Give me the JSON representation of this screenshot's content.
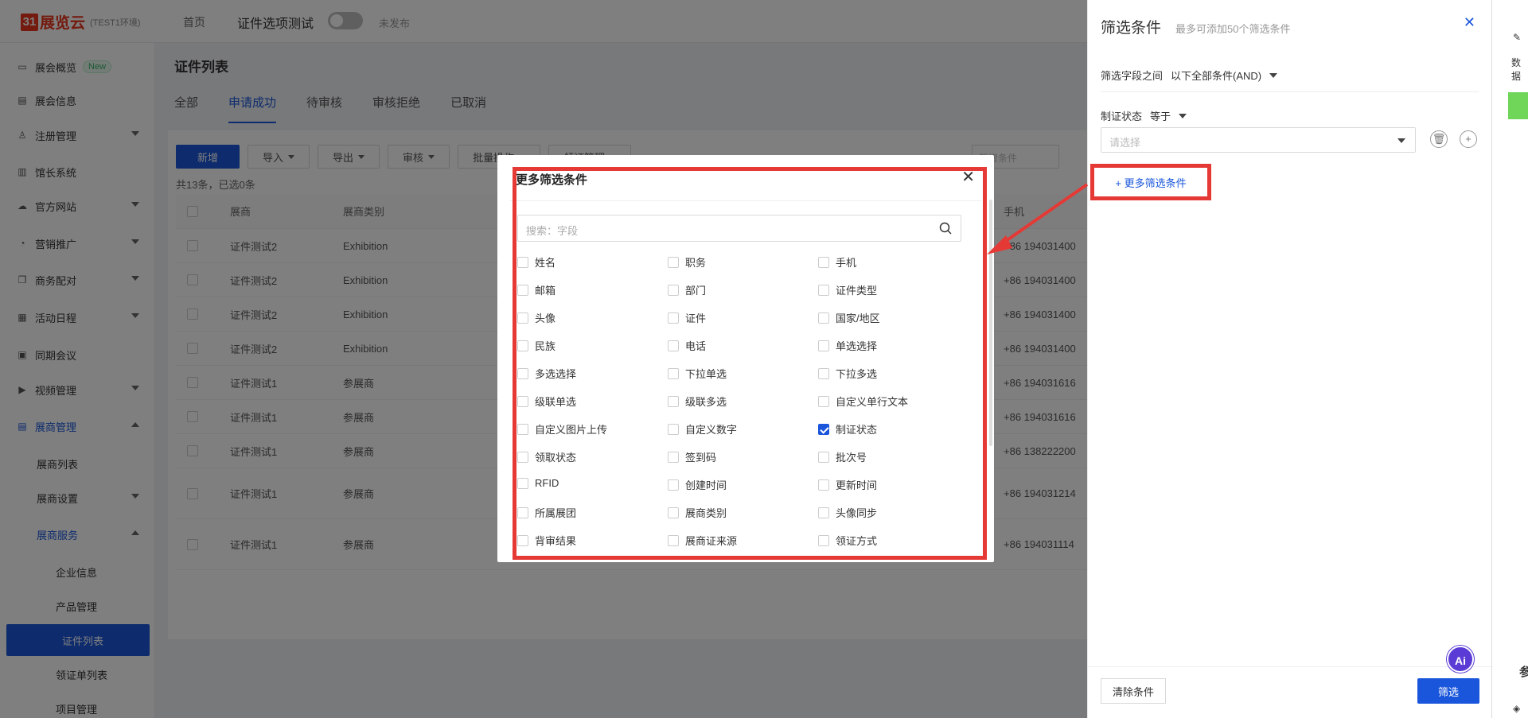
{
  "topbar": {
    "logo_mark": "31",
    "logo_text": "展览云",
    "env": "(TEST1环境)",
    "home": "首页",
    "event": "证件选项测试",
    "publish_status": "未发布"
  },
  "sidebar": {
    "items": [
      {
        "label": "展会概览",
        "badge": "New"
      },
      {
        "label": "展会信息"
      },
      {
        "label": "注册管理"
      },
      {
        "label": "馆长系统"
      },
      {
        "label": "官方网站"
      },
      {
        "label": "营销推广"
      },
      {
        "label": "商务配对"
      },
      {
        "label": "活动日程"
      },
      {
        "label": "同期会议"
      },
      {
        "label": "视频管理"
      },
      {
        "label": "展商管理"
      },
      {
        "label": "展商列表"
      },
      {
        "label": "展商设置"
      },
      {
        "label": "展商服务"
      },
      {
        "label": "企业信息"
      },
      {
        "label": "产品管理"
      },
      {
        "label": "证件列表"
      },
      {
        "label": "领证单列表"
      },
      {
        "label": "项目管理"
      }
    ]
  },
  "main": {
    "title": "证件列表",
    "tabs": [
      "全部",
      "申请成功",
      "待审核",
      "审核拒绝",
      "已取消"
    ],
    "toolbar": [
      "新增",
      "导入",
      "导出",
      "审核",
      "批量操作",
      "领证管理"
    ],
    "search_placeholder": "新增条件",
    "count": "共13条，已选0条",
    "headers": [
      "展商",
      "展商类别",
      "手机"
    ],
    "rows": [
      {
        "exhibitor": "证件测试2",
        "category": "Exhibition",
        "phone": "+86 194031400"
      },
      {
        "exhibitor": "证件测试2",
        "category": "Exhibition",
        "phone": "+86 194031400"
      },
      {
        "exhibitor": "证件测试2",
        "category": "Exhibition",
        "phone": "+86 194031400"
      },
      {
        "exhibitor": "证件测试2",
        "category": "Exhibition",
        "phone": "+86 194031400"
      },
      {
        "exhibitor": "证件测试1",
        "category": "参展商",
        "phone": "+86 194031616"
      },
      {
        "exhibitor": "证件测试1",
        "category": "参展商",
        "phone": "+86 194031616"
      },
      {
        "exhibitor": "证件测试1",
        "category": "参展商",
        "phone": "+86 138222200"
      },
      {
        "exhibitor": "证件测试1",
        "category": "参展商",
        "phone": "+86 194031214"
      },
      {
        "exhibitor": "证件测试1",
        "category": "参展商",
        "phone": "+86 194031114"
      }
    ]
  },
  "panel": {
    "title": "筛选条件",
    "subtitle": "最多可添加50个筛选条件",
    "logic_label": "筛选字段之间",
    "logic_value": "以下全部条件(AND)",
    "field_label": "制证状态",
    "operator": "等于",
    "select_placeholder": "请选择",
    "more": "+ 更多筛选条件",
    "clear": "清除条件",
    "filter": "筛选",
    "ai": "Ai"
  },
  "sliver": {
    "top_text": "数据",
    "bottom_text": "参"
  },
  "modal": {
    "title": "更多筛选条件",
    "search_placeholder": "搜索：字段",
    "options": [
      {
        "label": "姓名",
        "checked": false
      },
      {
        "label": "职务",
        "checked": false
      },
      {
        "label": "手机",
        "checked": false
      },
      {
        "label": "邮箱",
        "checked": false
      },
      {
        "label": "部门",
        "checked": false
      },
      {
        "label": "证件类型",
        "checked": false
      },
      {
        "label": "头像",
        "checked": false
      },
      {
        "label": "证件",
        "checked": false
      },
      {
        "label": "国家/地区",
        "checked": false
      },
      {
        "label": "民族",
        "checked": false
      },
      {
        "label": "电话",
        "checked": false
      },
      {
        "label": "单选选择",
        "checked": false
      },
      {
        "label": "多选选择",
        "checked": false
      },
      {
        "label": "下拉单选",
        "checked": false
      },
      {
        "label": "下拉多选",
        "checked": false
      },
      {
        "label": "级联单选",
        "checked": false
      },
      {
        "label": "级联多选",
        "checked": false
      },
      {
        "label": "自定义单行文本",
        "checked": false
      },
      {
        "label": "自定义图片上传",
        "checked": false
      },
      {
        "label": "自定义数字",
        "checked": false
      },
      {
        "label": "制证状态",
        "checked": true
      },
      {
        "label": "领取状态",
        "checked": false
      },
      {
        "label": "签到码",
        "checked": false
      },
      {
        "label": "批次号",
        "checked": false
      },
      {
        "label": "RFID",
        "checked": false
      },
      {
        "label": "创建时间",
        "checked": false
      },
      {
        "label": "更新时间",
        "checked": false
      },
      {
        "label": "所属展团",
        "checked": false
      },
      {
        "label": "展商类别",
        "checked": false
      },
      {
        "label": "头像同步",
        "checked": false
      },
      {
        "label": "背审结果",
        "checked": false
      },
      {
        "label": "展商证来源",
        "checked": false
      },
      {
        "label": "领证方式",
        "checked": false
      }
    ]
  },
  "colors": {
    "primary": "#1a56db",
    "highlight": "#e53935",
    "logo": "#e8341c"
  }
}
